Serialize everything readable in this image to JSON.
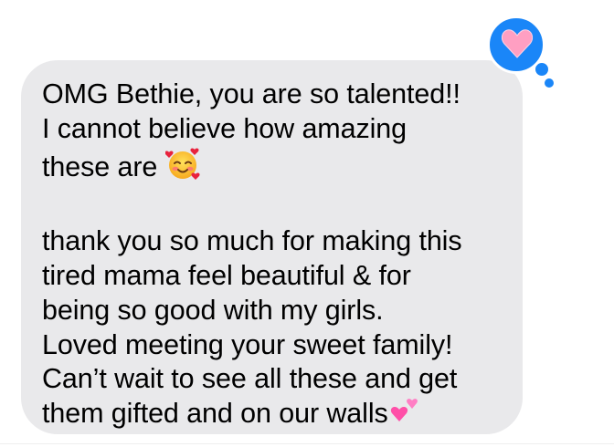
{
  "message": {
    "line1": "OMG Bethie, you are so talented!!",
    "line2": "I cannot believe how amazing",
    "line3": "these are",
    "line4": "thank you so much for making this",
    "line5": "tired mama feel beautiful & for",
    "line6": "being so good with my girls.",
    "line7": "Loved meeting your sweet family!",
    "line8": "Can’t wait to see all these and get",
    "line9": "them gifted and on our walls",
    "emoji_after_line3": "smiling-face-with-hearts-icon",
    "emoji_after_line9": "two-hearts-icon"
  },
  "tapback": {
    "reaction": "heart-icon",
    "bubble_color": "#1a86f8",
    "heart_color": "#ff9fc2"
  },
  "colors": {
    "bubble": "#e9e9eb",
    "text": "#000000",
    "background": "#ffffff"
  }
}
